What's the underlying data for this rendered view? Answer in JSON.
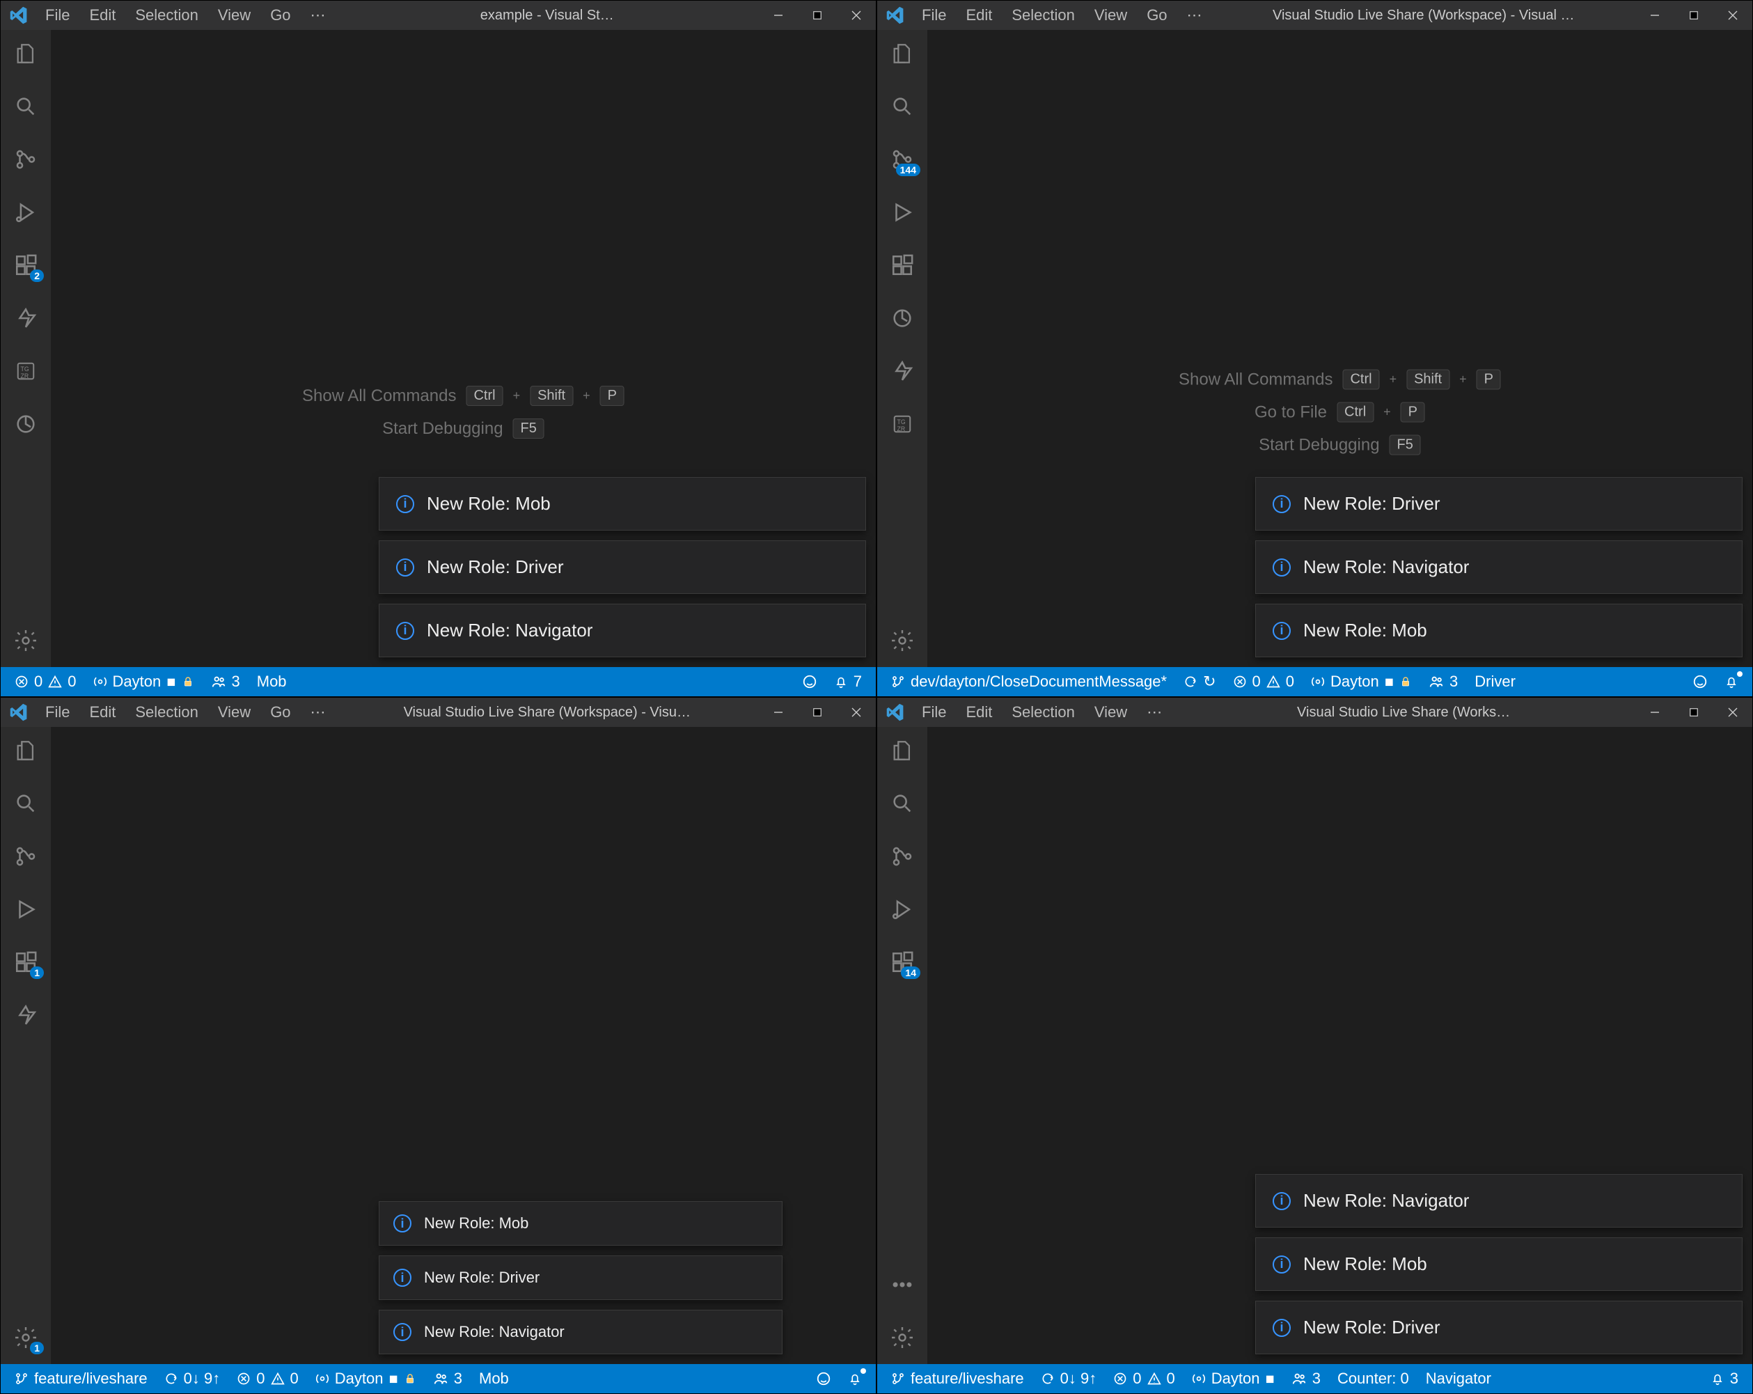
{
  "windows": [
    {
      "title": "example - Visual St…",
      "menus": [
        "File",
        "Edit",
        "Selection",
        "View",
        "Go",
        "⋯"
      ],
      "activity_badges": {
        "ext": "2"
      },
      "shortcuts": [
        {
          "label": "Show All Commands",
          "keys": [
            "Ctrl",
            "Shift",
            "P"
          ]
        },
        {
          "label": "Start Debugging",
          "keys": [
            "F5"
          ]
        }
      ],
      "notifs": [
        "New Role: Mob",
        "New Role: Driver",
        "New Role: Navigator"
      ],
      "status": {
        "branch": "",
        "sync": "",
        "errors": "0",
        "warnings": "0",
        "liveshare": "Dayton",
        "readonly": true,
        "participants": "3",
        "role": "Mob",
        "right": [
          {
            "t": "feedback"
          },
          {
            "t": "bell",
            "badge": "7"
          }
        ]
      }
    },
    {
      "title": "Visual Studio Live Share (Workspace) - Visual …",
      "menus": [
        "File",
        "Edit",
        "Selection",
        "View",
        "Go",
        "⋯"
      ],
      "activity_badges": {
        "scm": "144"
      },
      "shortcuts": [
        {
          "label": "Show All Commands",
          "keys": [
            "Ctrl",
            "Shift",
            "P"
          ]
        },
        {
          "label": "Go to File",
          "keys": [
            "Ctrl",
            "P"
          ]
        },
        {
          "label": "Start Debugging",
          "keys": [
            "F5"
          ]
        }
      ],
      "notifs": [
        "New Role: Driver",
        "New Role: Navigator",
        "New Role: Mob"
      ],
      "status": {
        "branch": "dev/dayton/CloseDocumentMessage*",
        "sync": "↻",
        "errors": "0",
        "warnings": "0",
        "liveshare": "Dayton",
        "readonly": true,
        "participants": "3",
        "role": "Driver",
        "right": [
          {
            "t": "feedback"
          },
          {
            "t": "belldot"
          }
        ]
      }
    },
    {
      "title": "Visual Studio Live Share (Workspace) - Visu…",
      "menus": [
        "File",
        "Edit",
        "Selection",
        "View",
        "Go",
        "⋯"
      ],
      "activity_badges": {
        "ext": "1",
        "gear": "1"
      },
      "shortcuts": [],
      "notifs_sm": [
        "New Role: Mob",
        "New Role: Driver",
        "New Role: Navigator"
      ],
      "status": {
        "branch": "feature/liveshare",
        "sync": "0↓ 9↑",
        "errors": "0",
        "warnings": "0",
        "liveshare": "Dayton",
        "readonly": true,
        "participants": "3",
        "role": "Mob",
        "right": [
          {
            "t": "feedback"
          },
          {
            "t": "belldot"
          }
        ]
      }
    },
    {
      "title": "Visual Studio Live Share (Works…",
      "menus": [
        "File",
        "Edit",
        "Selection",
        "View",
        "⋯"
      ],
      "activity_badges": {
        "ext": "14"
      },
      "shortcuts": [],
      "notifs": [
        "New Role: Navigator",
        "New Role: Mob",
        "New Role: Driver"
      ],
      "status": {
        "branch": "feature/liveshare",
        "sync": "0↓ 9↑",
        "errors": "0",
        "warnings": "0",
        "liveshare": "Dayton",
        "readonly": false,
        "participants": "3",
        "counter": "Counter: 0",
        "role": "Navigator",
        "right": [
          {
            "t": "bell",
            "badge": "3"
          }
        ]
      }
    }
  ]
}
